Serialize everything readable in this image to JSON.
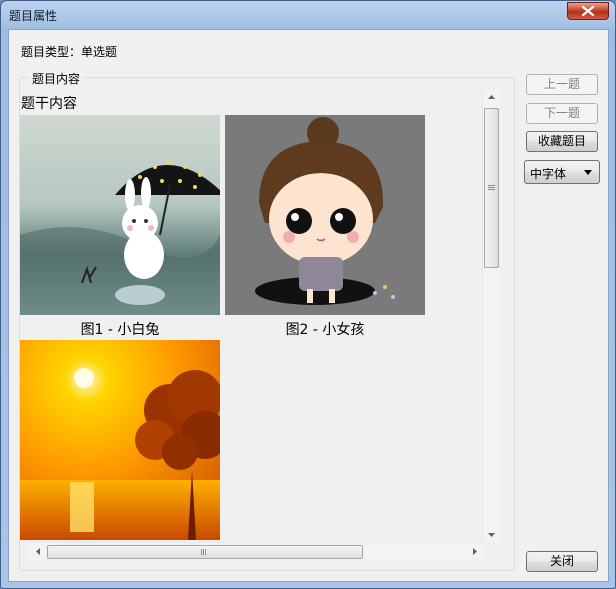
{
  "window": {
    "title": "题目属性"
  },
  "question": {
    "type_label": "题目类型：单选题",
    "group_label": "题目内容",
    "stem": "题干内容",
    "figures": [
      {
        "caption": "图1 - 小白兔",
        "image": "rabbit-umbrella-picture"
      },
      {
        "caption": "图2 - 小女孩",
        "image": "girl-in-rain-picture"
      },
      {
        "caption": "",
        "image": "sunset-tree-picture"
      }
    ]
  },
  "buttons": {
    "prev": "上一题",
    "next": "下一题",
    "favorite": "收藏题目",
    "close": "关闭"
  },
  "font_select": {
    "selected": "中字体"
  },
  "colors": {
    "title_bar": "#a9c4e6",
    "close_button": "#c8462f",
    "dialog_bg": "#f0f0f0"
  }
}
